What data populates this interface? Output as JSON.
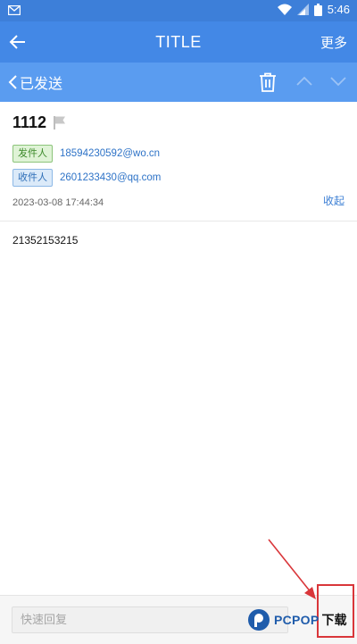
{
  "status_bar": {
    "time": "5:46"
  },
  "app_bar": {
    "title": "TITLE",
    "more_label": "更多"
  },
  "toolbar": {
    "sent_label": "已发送"
  },
  "email": {
    "subject": "1112",
    "from_tag": "发件人",
    "from_address": "18594230592@wo.cn",
    "to_tag": "收件人",
    "to_address": "2601233430@qq.com",
    "date": "2023-03-08 17:44:34",
    "collapse_label": "收起",
    "body": "21352153215"
  },
  "reply": {
    "placeholder": "快速回复"
  },
  "watermark": {
    "brand": "PCPOP",
    "suffix": "下载"
  },
  "colors": {
    "status_bar": "#3d7fd9",
    "app_bar": "#4388e6",
    "toolbar": "#5a9cf0",
    "link": "#2e73c7",
    "annotation": "#d9363a"
  },
  "icons": [
    "mail-icon",
    "wifi-icon",
    "signal-icon",
    "battery-icon",
    "back-arrow-icon",
    "chevron-left-icon",
    "trash-icon",
    "chevron-up-icon",
    "chevron-down-icon",
    "flag-icon",
    "send-icon"
  ]
}
